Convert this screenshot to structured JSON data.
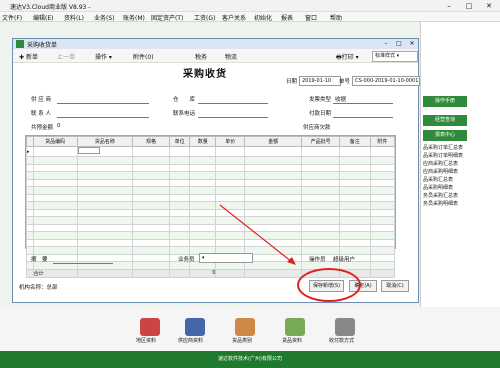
{
  "app": {
    "title": "速达V3.Cloud商业版 V8.93 - ",
    "menu": [
      "文件(F)",
      "编辑(E)",
      "资料(L)",
      "业务(S)",
      "账务(M)",
      "固定资产(T)",
      "工资(G)",
      "客户关系",
      "初始化",
      "报表",
      "窗口",
      "帮助"
    ]
  },
  "right_panel": {
    "buttons": [
      "操作手册",
      "经营查询",
      "报表中心"
    ],
    "links": [
      "品采购订单汇总表",
      "品采购订单明细表",
      "应商采购汇总表",
      "应商采购明细表",
      "品采购汇总表",
      "品采购明细表",
      "务员采购汇总表",
      "务员采购明细表"
    ]
  },
  "bottom": {
    "icons": [
      "地区资料",
      "供应商资料",
      "货品类别",
      "货品资料",
      "收付款方式"
    ],
    "footer": "速达软件技术(广州)有限公司"
  },
  "dialog": {
    "title": "采购收货单",
    "toolbar": {
      "new": "新单",
      "prev": "上一单",
      "ops": "操作",
      "attach": "附件(0)",
      "tax": "税务",
      "logistics": "物流",
      "print": "打印",
      "print_style": "标准样式"
    },
    "doc_title": "采购收货",
    "date_label": "日期",
    "date": "2019-01-10",
    "no_label": "单号",
    "no": "CS-000-2019-01-10-0001",
    "supplier": "供 应 商",
    "warehouse": "仓　　库",
    "invoice_type": "发票类型",
    "invoice_value": "收据",
    "contact": "联 系 人",
    "phone": "联系电话",
    "pay_date": "付款日期",
    "deposit": "共预金额",
    "deposit_value": "0",
    "supplier_owed": "供应商欠款",
    "summary": "摘　要",
    "salesman": "业务员",
    "operator": "操作员",
    "operator_value": "超级用户",
    "org": "机构名称：总部",
    "save": "保存新增(S)",
    "confirm": "确定(A)",
    "cancel": "取消(C)"
  },
  "grid": {
    "columns": [
      "货品编码",
      "货品名称",
      "规格",
      "单位",
      "数量",
      "单价",
      "金额",
      "产品批号",
      "备注",
      "附件"
    ],
    "rows": 16,
    "total_label": "合计",
    "total_qty": "0"
  }
}
